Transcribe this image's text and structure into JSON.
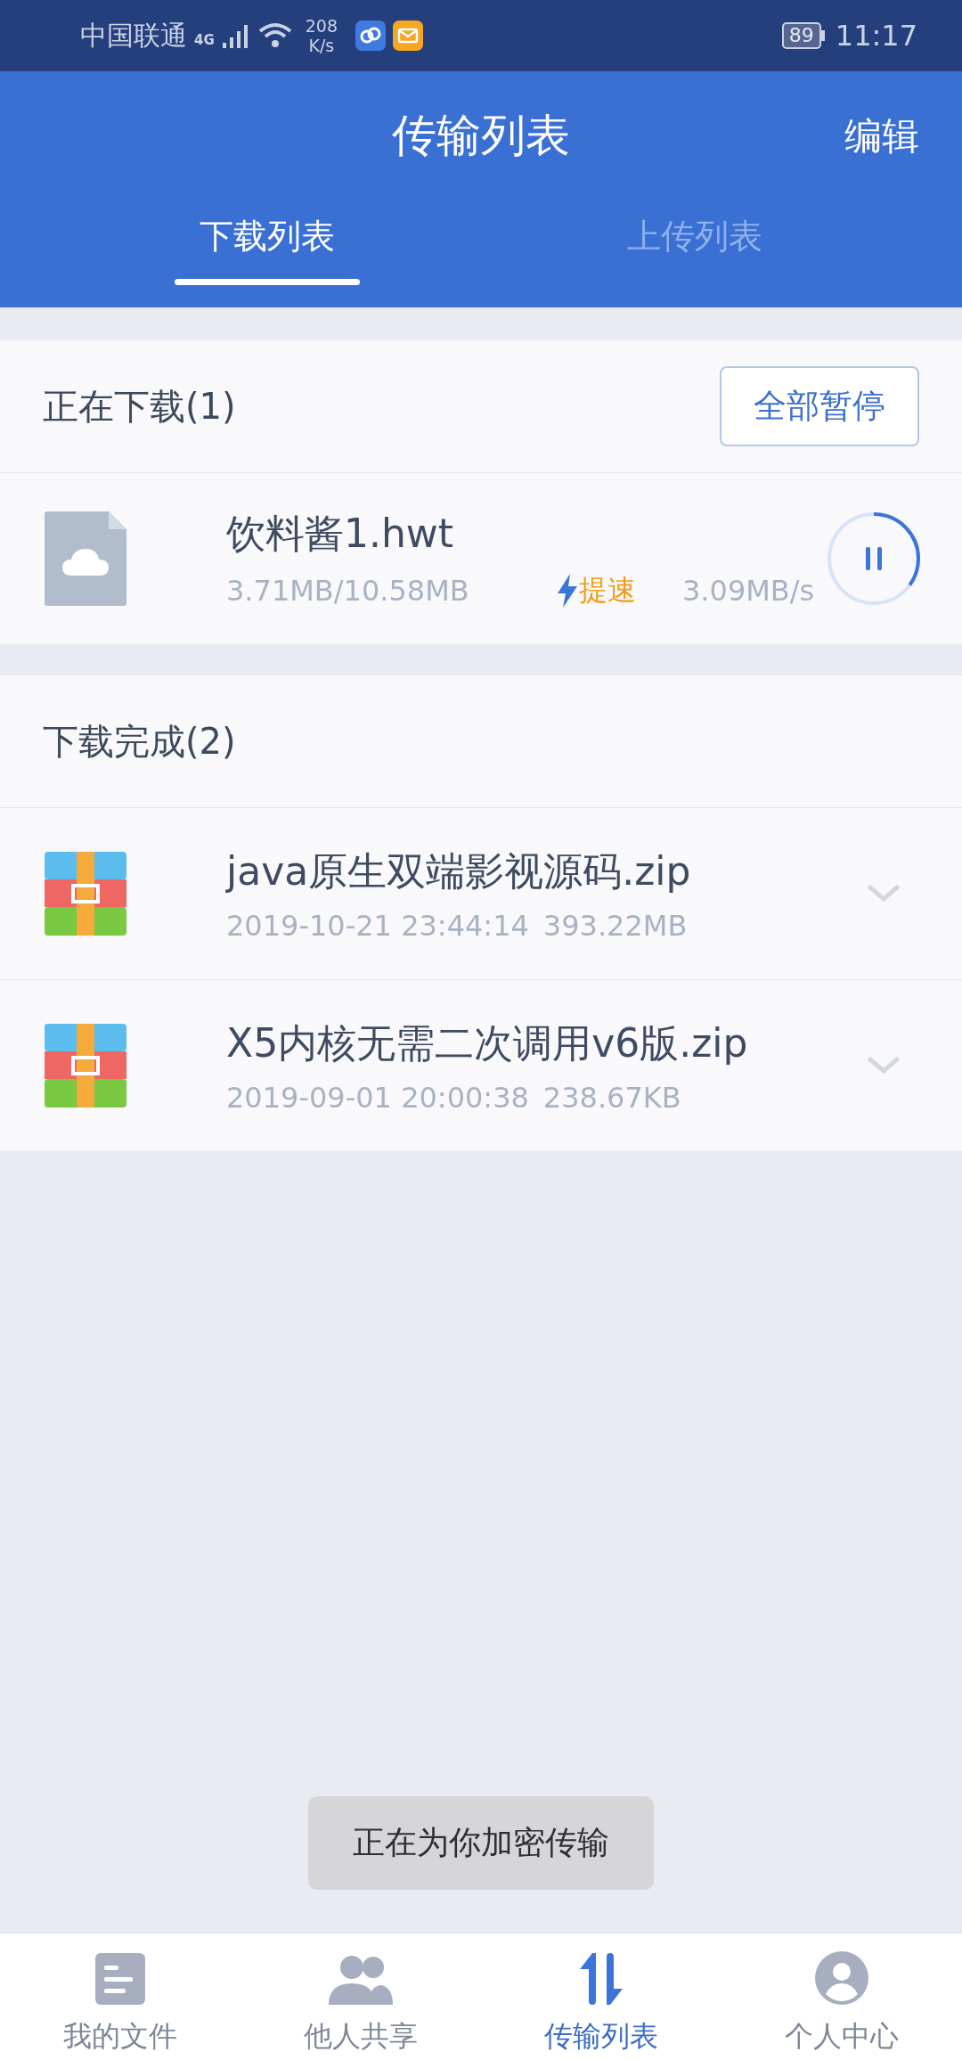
{
  "status_bar": {
    "carrier": "中国联通",
    "network": "4G",
    "speed_value": "208",
    "speed_unit": "K/s",
    "battery": "89",
    "time": "11:17"
  },
  "header": {
    "title": "传输列表",
    "action": "编辑"
  },
  "tabs": [
    {
      "label": "下载列表",
      "selected": true
    },
    {
      "label": "上传列表",
      "selected": false
    }
  ],
  "downloading": {
    "title": "正在下载(1)",
    "button": "全部暂停",
    "items": [
      {
        "name": "饮料酱1.hwt",
        "progress": "3.71MB/10.58MB",
        "boost": "提速",
        "speed": "3.09MB/s",
        "level": 0.35
      }
    ]
  },
  "completed": {
    "title": "下载完成(2)",
    "items": [
      {
        "name": "java原生双端影视源码.zip",
        "date": "2019-10-21 23:44:14",
        "size": "393.22MB"
      },
      {
        "name": "X5内核无需二次调用v6版.zip",
        "date": "2019-09-01 20:00:38",
        "size": "238.67KB"
      }
    ]
  },
  "toast": "正在为你加密传输",
  "bottom_nav": [
    {
      "label": "我的文件",
      "kind": "files",
      "selected": false
    },
    {
      "label": "他人共享",
      "kind": "shared",
      "selected": false
    },
    {
      "label": "传输列表",
      "kind": "transfer",
      "selected": true
    },
    {
      "label": "个人中心",
      "kind": "profile",
      "selected": false
    }
  ]
}
